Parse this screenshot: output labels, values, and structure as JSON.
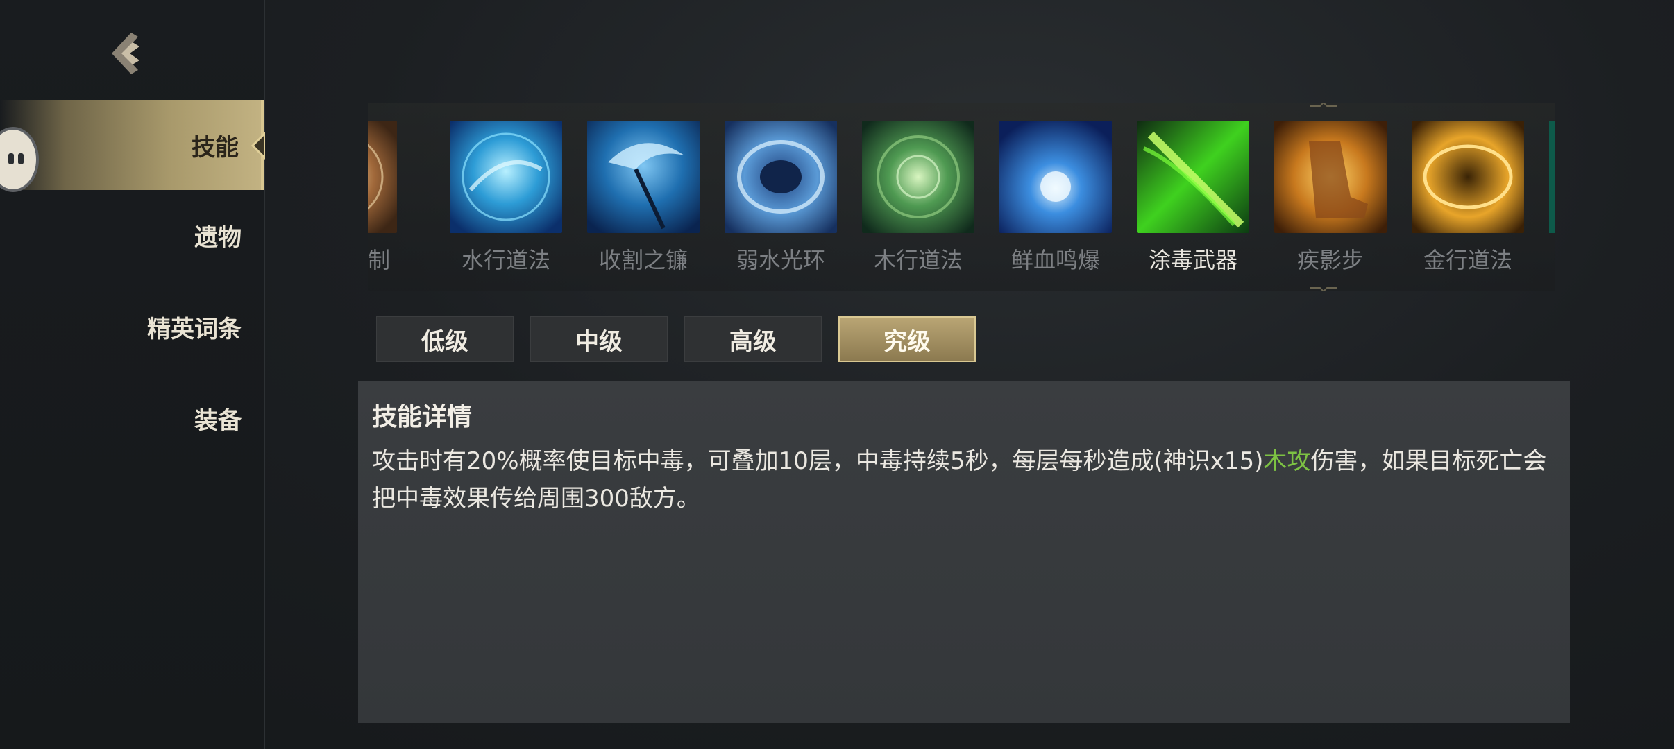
{
  "sidebar": {
    "items": [
      {
        "label": "技能",
        "active": true
      },
      {
        "label": "遗物",
        "active": false
      },
      {
        "label": "精英词条",
        "active": false
      },
      {
        "label": "装备",
        "active": false
      }
    ]
  },
  "skills": [
    {
      "label": "禁制",
      "icon": "forbid-skill-icon"
    },
    {
      "label": "水行道法",
      "icon": "water-dao-icon"
    },
    {
      "label": "收割之镰",
      "icon": "reaping-scythe-icon"
    },
    {
      "label": "弱水光环",
      "icon": "weak-water-aura-icon"
    },
    {
      "label": "木行道法",
      "icon": "wood-dao-icon"
    },
    {
      "label": "鲜血鸣爆",
      "icon": "blood-burst-icon"
    },
    {
      "label": "涂毒武器",
      "icon": "poison-weapon-icon",
      "selected": true
    },
    {
      "label": "疾影步",
      "icon": "shadow-step-icon"
    },
    {
      "label": "金行道法",
      "icon": "metal-dao-icon"
    }
  ],
  "tiers": [
    {
      "label": "低级",
      "active": false
    },
    {
      "label": "中级",
      "active": false
    },
    {
      "label": "高级",
      "active": false
    },
    {
      "label": "究级",
      "active": true
    }
  ],
  "detail": {
    "title": "技能详情",
    "text_before": "攻击时有20%概率使目标中毒，可叠加10层，中毒持续5秒，每层每秒造成(神识x15)",
    "highlight": "木攻",
    "text_after": "伤害，如果目标死亡会把中毒效果传给周围300敌方。"
  },
  "colors": {
    "accent_gold": "#c2b282",
    "highlight_green": "#7dc243"
  }
}
